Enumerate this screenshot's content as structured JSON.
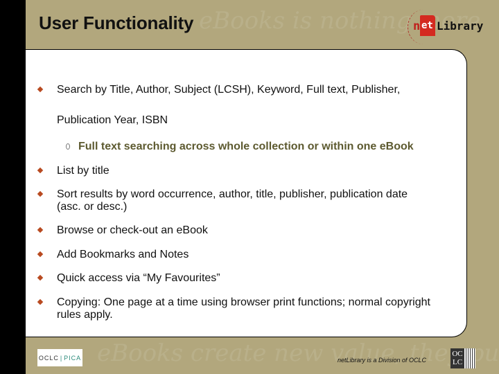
{
  "header": {
    "title": "User Functionality",
    "watermark_top": "eBooks is nothing more",
    "logo": {
      "n": "n",
      "et": "et",
      "library": "Library",
      "icon": "book-icon"
    }
  },
  "bullets": [
    {
      "text": "Search by Title, Author, Subject (LCSH), Keyword, Full text, Publisher,",
      "continuation": "Publication Year, ISBN"
    },
    {
      "text": "List by title"
    },
    {
      "text": "Sort results by word occurrence, author, title, publisher, publication date",
      "continuation": "(asc. or desc.)"
    },
    {
      "text": "Browse or check-out an eBook"
    },
    {
      "text": "Add Bookmarks and Notes"
    },
    {
      "text": "Quick access via “My Favourites”"
    },
    {
      "text": "Copying: One page at a time using browser print functions; normal copyright",
      "continuation": "rules apply."
    }
  ],
  "sub_bullets": [
    {
      "text": "Full text searching across whole collection or within one eBook"
    }
  ],
  "footer": {
    "watermark_bottom": "eBooks create new value, they put to",
    "oclc_pica_left": "OCLC",
    "oclc_pica_right": "PICA",
    "note": "netLibrary is a Division of OCLC",
    "oclc_logo_top": "OC",
    "oclc_logo_bottom": "LC"
  },
  "colors": {
    "background": "#b2a77d",
    "bullet": "#b84a20",
    "sub_bullet_text": "#5d5a30"
  }
}
